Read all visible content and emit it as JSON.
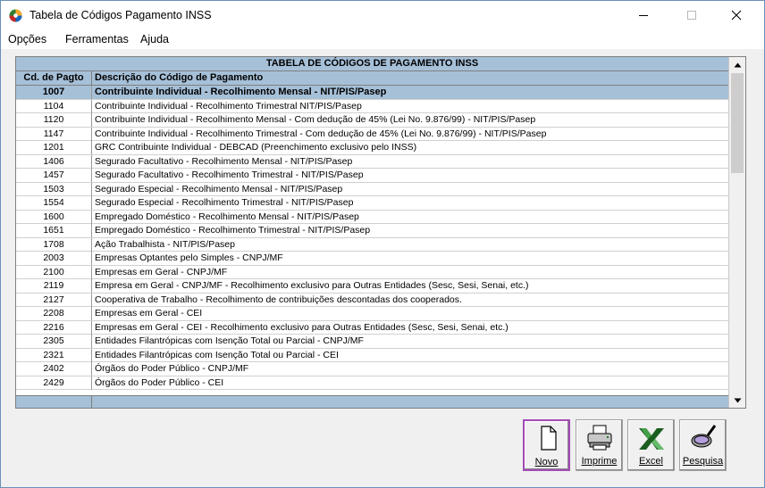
{
  "window": {
    "title": "Tabela de Códigos Pagamento INSS",
    "controls": {
      "minimize_icon": "minimize-icon",
      "maximize_icon": "maximize-icon",
      "close_icon": "close-icon"
    }
  },
  "menu": [
    "Opções",
    "Ferramentas",
    "Ajuda"
  ],
  "table": {
    "caption": "TABELA DE CÓDIGOS DE PAGAMENTO INSS",
    "columns": [
      "Cd. de Pagto",
      "Descrição do Código de Pagamento"
    ],
    "selected_index": 0,
    "rows": [
      {
        "code": "1007",
        "desc": "Contribuinte Individual - Recolhimento Mensal - NIT/PIS/Pasep"
      },
      {
        "code": "1104",
        "desc": "Contribuinte Individual - Recolhimento Trimestral NIT/PIS/Pasep"
      },
      {
        "code": "1120",
        "desc": "Contribuinte Individual - Recolhimento Mensal - Com dedução de 45% (Lei No. 9.876/99) - NIT/PIS/Pasep"
      },
      {
        "code": "1147",
        "desc": "Contribuinte Individual - Recolhimento Trimestral - Com dedução de 45% (Lei No. 9.876/99) - NIT/PIS/Pasep"
      },
      {
        "code": "1201",
        "desc": "GRC Contribuinte Individual - DEBCAD (Preenchimento exclusivo pelo INSS)"
      },
      {
        "code": "1406",
        "desc": "Segurado Facultativo - Recolhimento Mensal - NIT/PIS/Pasep"
      },
      {
        "code": "1457",
        "desc": "Segurado Facultativo - Recolhimento Trimestral - NIT/PIS/Pasep"
      },
      {
        "code": "1503",
        "desc": "Segurado Especial - Recolhimento Mensal - NIT/PIS/Pasep"
      },
      {
        "code": "1554",
        "desc": "Segurado Especial - Recolhimento Trimestral - NIT/PIS/Pasep"
      },
      {
        "code": "1600",
        "desc": "Empregado Doméstico - Recolhimento Mensal - NIT/PIS/Pasep"
      },
      {
        "code": "1651",
        "desc": "Empregado Doméstico - Recolhimento Trimestral - NIT/PIS/Pasep"
      },
      {
        "code": "1708",
        "desc": "Ação Trabalhista - NIT/PIS/Pasep"
      },
      {
        "code": "2003",
        "desc": "Empresas Optantes pelo Simples - CNPJ/MF"
      },
      {
        "code": "2100",
        "desc": "Empresas em Geral - CNPJ/MF"
      },
      {
        "code": "2119",
        "desc": "Empresa em Geral - CNPJ/MF - Recolhimento exclusivo para Outras Entidades (Sesc, Sesi, Senai, etc.)"
      },
      {
        "code": "2127",
        "desc": "Cooperativa de Trabalho - Recolhimento de contribuições descontadas dos cooperados."
      },
      {
        "code": "2208",
        "desc": "Empresas em Geral - CEI"
      },
      {
        "code": "2216",
        "desc": "Empresas em Geral - CEI - Recolhimento exclusivo para Outras Entidades (Sesc, Sesi, Senai, etc.)"
      },
      {
        "code": "2305",
        "desc": "Entidades Filantrópicas com Isenção Total ou Parcial - CNPJ/MF"
      },
      {
        "code": "2321",
        "desc": "Entidades Filantrópicas com Isenção Total ou Parcial - CEI"
      },
      {
        "code": "2402",
        "desc": "Órgãos do Poder Público - CNPJ/MF"
      },
      {
        "code": "2429",
        "desc": "Órgãos do Poder Público - CEI"
      }
    ]
  },
  "toolbar": {
    "novo": {
      "label": "Novo",
      "icon": "document-icon"
    },
    "imprime": {
      "label": "Imprime",
      "icon": "printer-icon"
    },
    "excel": {
      "label": "Excel",
      "icon": "excel-icon"
    },
    "pesquisa": {
      "label": "Pesquisa",
      "icon": "magnifier-icon"
    }
  },
  "colors": {
    "header_bg": "#a6c0d8",
    "focus_border": "#a24bb5"
  }
}
